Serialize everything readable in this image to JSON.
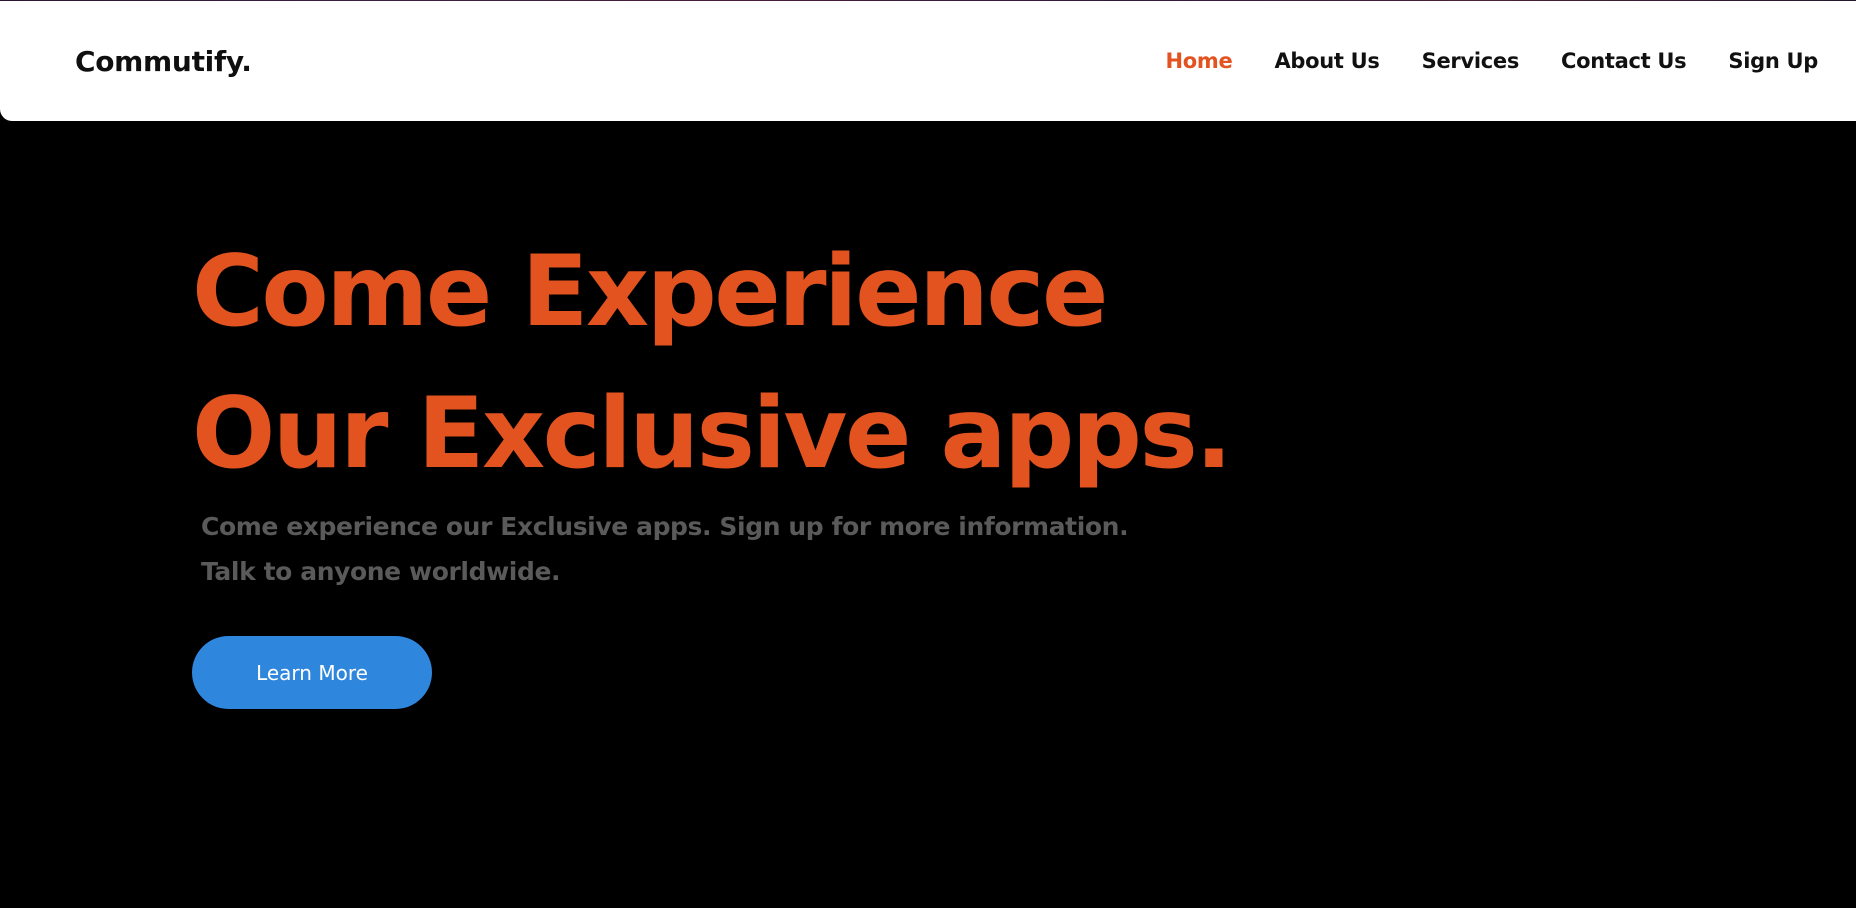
{
  "header": {
    "brand": "Commutify.",
    "nav": [
      {
        "label": "Home",
        "active": true
      },
      {
        "label": "About Us",
        "active": false
      },
      {
        "label": "Services",
        "active": false
      },
      {
        "label": "Contact Us",
        "active": false
      },
      {
        "label": "Sign Up",
        "active": false
      }
    ]
  },
  "hero": {
    "title_line1": "Come Experience",
    "title_line2": "Our Exclusive apps.",
    "subtitle_line1": "Come experience our Exclusive apps. Sign up for more information.",
    "subtitle_line2": "Talk to anyone worldwide.",
    "cta_label": "Learn More"
  },
  "colors": {
    "accent": "#e2531f",
    "button": "#2f86dd",
    "background": "#000000",
    "navbar": "#ffffff",
    "subtitle": "#5a5a5a"
  }
}
